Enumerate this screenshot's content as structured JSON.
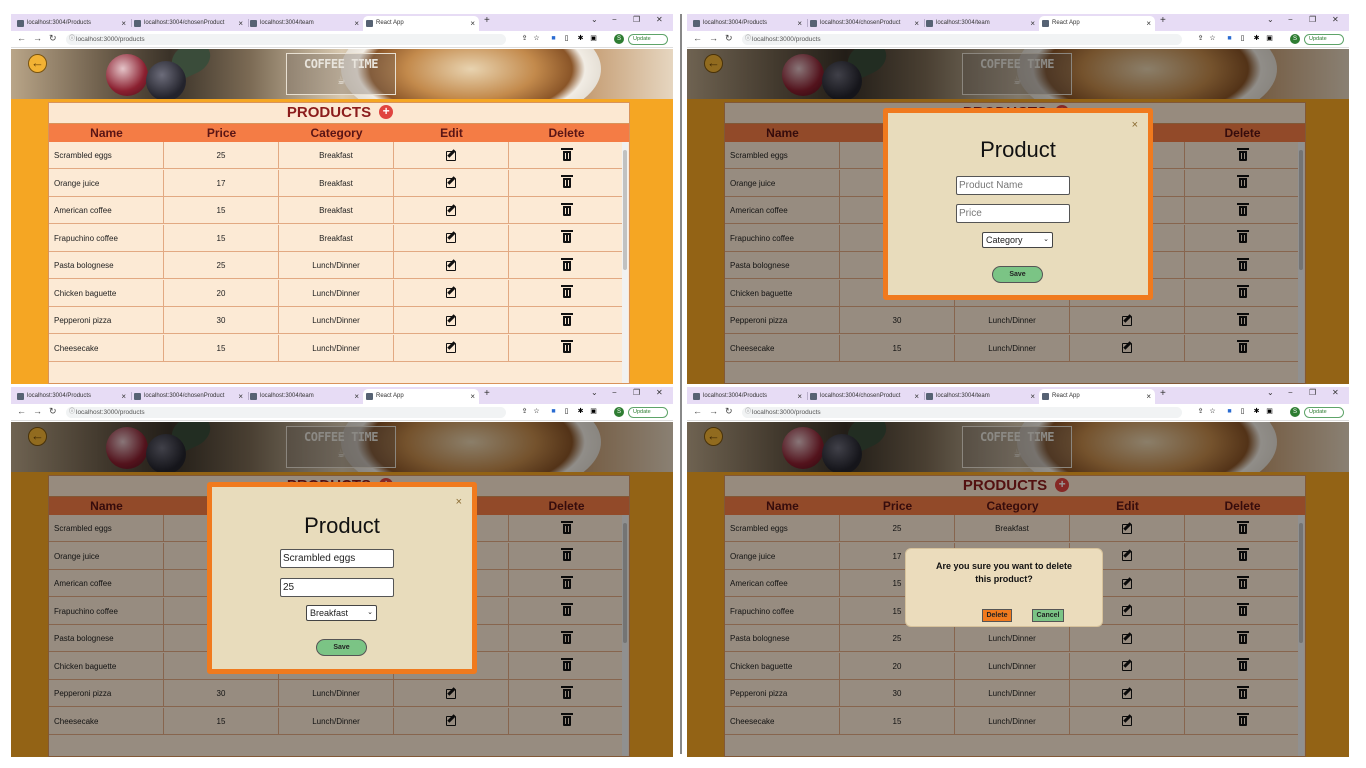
{
  "browser": {
    "tabs": [
      {
        "title": "localhost:3004/Products"
      },
      {
        "title": "localhost:3004/chosenProduct"
      },
      {
        "title": "localhost:3004/team"
      },
      {
        "title": "React App"
      }
    ],
    "new_tab": "+",
    "url": "localhost:3000/products",
    "update_label": "Update",
    "profile_initial": "S"
  },
  "header": {
    "back_arrow": "←",
    "logo_text": "COFFEE TIME"
  },
  "products_table": {
    "title": "PRODUCTS",
    "add_symbol": "+",
    "columns": [
      "Name",
      "Price",
      "Category",
      "Edit",
      "Delete"
    ],
    "rows": [
      {
        "name": "Scrambled eggs",
        "price": "25",
        "category": "Breakfast"
      },
      {
        "name": "Orange juice",
        "price": "17",
        "category": "Breakfast"
      },
      {
        "name": "American coffee",
        "price": "15",
        "category": "Breakfast"
      },
      {
        "name": "Frapuchino coffee",
        "price": "15",
        "category": "Breakfast"
      },
      {
        "name": "Pasta bolognese",
        "price": "25",
        "category": "Lunch/Dinner"
      },
      {
        "name": "Chicken baguette",
        "price": "20",
        "category": "Lunch/Dinner"
      },
      {
        "name": "Pepperoni pizza",
        "price": "30",
        "category": "Lunch/Dinner"
      },
      {
        "name": "Cheesecake",
        "price": "15",
        "category": "Lunch/Dinner"
      }
    ]
  },
  "add_modal": {
    "title": "Product",
    "close": "×",
    "name_placeholder": "Product Name",
    "price_placeholder": "Price",
    "category_placeholder": "Category",
    "save_label": "Save"
  },
  "edit_modal": {
    "title": "Product",
    "close": "×",
    "name_value": "Scrambled eggs",
    "price_value": "25",
    "category_value": "Breakfast",
    "save_label": "Save"
  },
  "delete_confirm": {
    "message": "Are you sure you want to delete this product?",
    "delete_label": "Delete",
    "cancel_label": "Cancel"
  },
  "colors": {
    "page_bg": "#f5a623",
    "table_bg": "#fcead5",
    "header_row": "#f47c45",
    "title_text": "#8b1c1c",
    "modal_border": "#f07a1e",
    "modal_bg": "#e8dcbc",
    "save_button": "#7bc485",
    "delete_button": "#f07a1e",
    "cancel_button": "#7bc485"
  },
  "panels": [
    {
      "id": "list-view"
    },
    {
      "id": "add-product-modal"
    },
    {
      "id": "edit-product-modal"
    },
    {
      "id": "delete-confirmation"
    }
  ]
}
